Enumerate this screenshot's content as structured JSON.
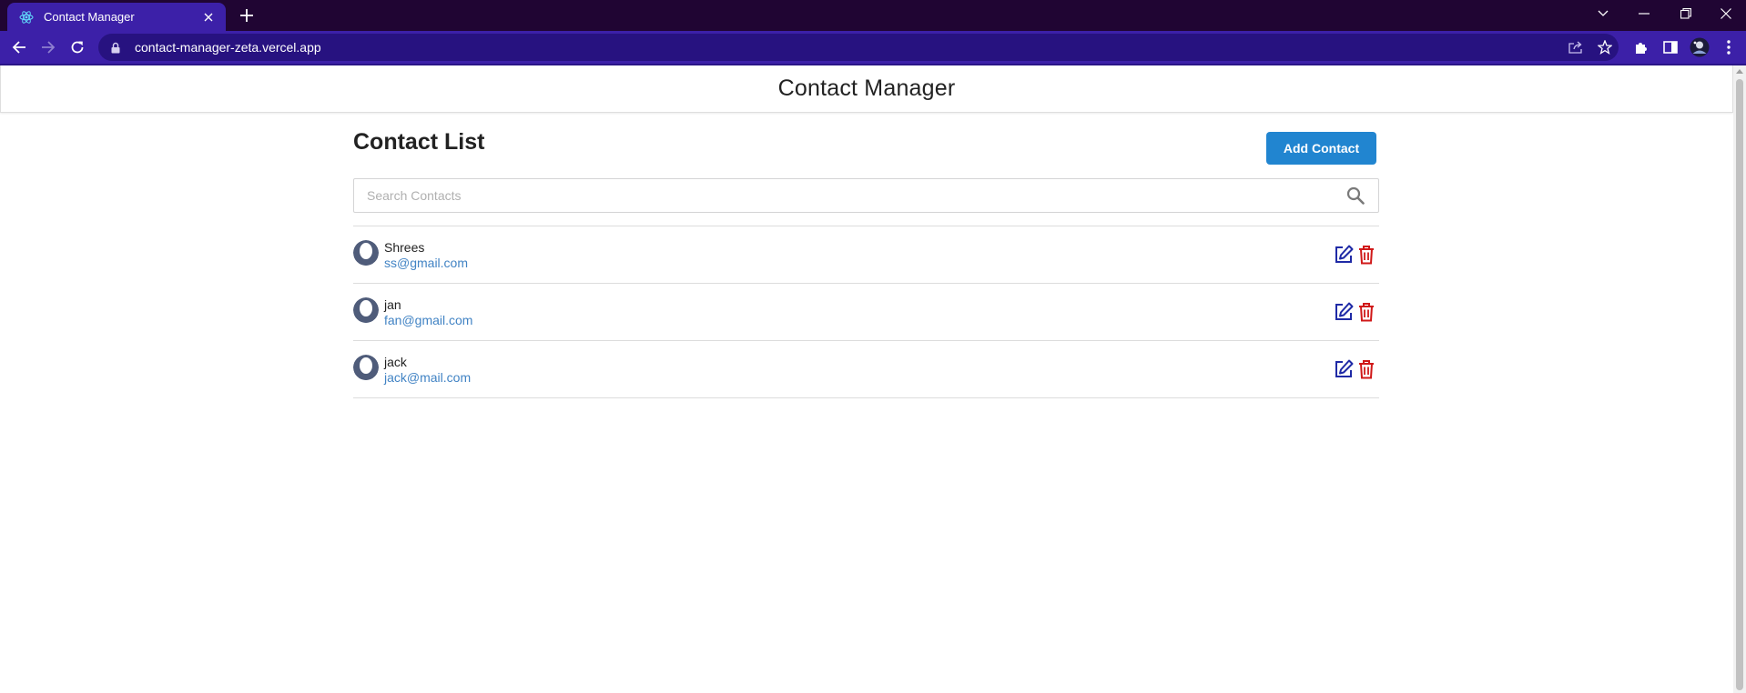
{
  "browser": {
    "tab_title": "Contact Manager",
    "url": "contact-manager-zeta.vercel.app",
    "icons": {
      "favicon": "react-atom-icon",
      "tab_close": "close-icon",
      "new_tab": "plus-icon",
      "back": "arrow-left-icon",
      "forward": "arrow-right-icon",
      "reload": "reload-icon",
      "lock": "lock-icon",
      "share": "share-icon",
      "bookmark": "star-icon",
      "extensions": "puzzle-icon",
      "side_panel": "side-panel-icon",
      "profile": "avatar",
      "menu": "kebab-menu-icon"
    },
    "colors": {
      "tabbar": "#200533",
      "toolbar": "#3c20a8",
      "omnibox": "#271280"
    }
  },
  "app": {
    "header_title": "Contact Manager",
    "list_title": "Contact List",
    "add_button_label": "Add Contact",
    "search": {
      "placeholder": "Search Contacts",
      "value": ""
    },
    "colors": {
      "primary": "#2185d0",
      "email": "#4183c4",
      "edit": "#1f2aa6",
      "delete": "#d01919"
    }
  },
  "contacts": [
    {
      "name": "Shrees",
      "email": "ss@gmail.com"
    },
    {
      "name": "jan",
      "email": "fan@gmail.com"
    },
    {
      "name": "jack",
      "email": "jack@mail.com"
    }
  ]
}
